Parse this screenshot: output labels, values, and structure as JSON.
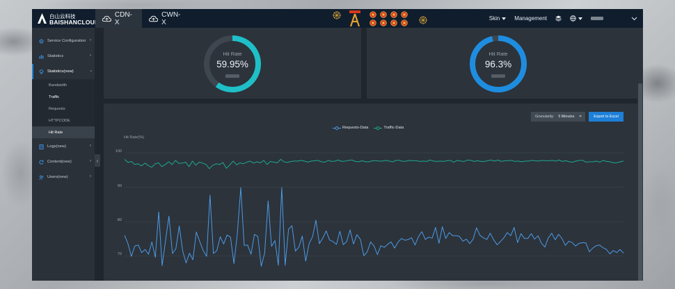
{
  "brand": {
    "cn": "白山云科技",
    "en": "BAISHANCLOUD"
  },
  "tabs": [
    {
      "label": "CDN-X",
      "active": true
    },
    {
      "label": "CWN-X",
      "active": false
    }
  ],
  "header": {
    "skin_label": "Skin",
    "management_label": "Management"
  },
  "sidebar": {
    "items": [
      {
        "label": "Service Configuration",
        "icon": "gear-icon"
      },
      {
        "label": "Statistics",
        "icon": "bar-chart-icon"
      },
      {
        "label": "Statistics(new)",
        "icon": "bulb-icon"
      },
      {
        "label": "Logs(new)",
        "icon": "document-icon"
      },
      {
        "label": "Content(new)",
        "icon": "refresh-icon"
      },
      {
        "label": "Users(new)",
        "icon": "users-icon"
      }
    ],
    "sub_items": [
      {
        "label": "Bandwidth"
      },
      {
        "label": "Traffic"
      },
      {
        "label": "Requests"
      },
      {
        "label": "HTTPCODE"
      },
      {
        "label": "Hit Rate"
      }
    ]
  },
  "gauges": [
    {
      "label": "Hit Rate",
      "value": "59.95%",
      "fraction": 0.5995,
      "color": "#1fbfc7",
      "track": "#3e464f"
    },
    {
      "label": "Hit Rate",
      "value": "96.3%",
      "fraction": 0.963,
      "color": "#1e8de0",
      "track": "#3e464f"
    }
  ],
  "controls": {
    "granularity_label": "Granularity:",
    "granularity_value": "5 Minutes",
    "export_label": "Export to Excel"
  },
  "chart_data": {
    "type": "line",
    "ylabel": "Hit Rate(%)",
    "yticks": [
      "100",
      "90",
      "80",
      "70"
    ],
    "ylim": [
      66,
      100
    ],
    "grid": true,
    "legend_position": "top-center",
    "series": [
      {
        "name": "Requests-Data",
        "color": "#4d9be6",
        "values": [
          76.0,
          73.6,
          69.9,
          72.9,
          73.2,
          71.0,
          71.9,
          70.5,
          74.1,
          69.6,
          82.8,
          67.2,
          74.5,
          81.6,
          70.7,
          72.1,
          78.7,
          71.5,
          68.0,
          70.8,
          68.9,
          77.0,
          74.2,
          71.6,
          69.9,
          87.7,
          70.7,
          71.6,
          75.6,
          73.5,
          76.1,
          75.5,
          67.8,
          76.6,
          89.9,
          73.1,
          73.2,
          70.5,
          76.3,
          75.7,
          67.0,
          70.8,
          86.0,
          72.8,
          74.5,
          67.3,
          89.9,
          67.3,
          77.8,
          78.8,
          71.4,
          72.6,
          75.8,
          68.5,
          73.6,
          75.6,
          80.4,
          73.6,
          75.2,
          77.3,
          74.6,
          74.2,
          73.4,
          77.2,
          73.3,
          74.2,
          77.6,
          73.5,
          76.2,
          74.8,
          70.1,
          71.2,
          74.1,
          72.9,
          70.4,
          73.0,
          72.5,
          73.4,
          74.1,
          72.3,
          74.0,
          75.1,
          74.6,
          74.8,
          75.3,
          73.2,
          75.6,
          77.1,
          74.8,
          75.5,
          75.2,
          78.3,
          73.7,
          78.5,
          75.1,
          76.8,
          75.9,
          75.9,
          75.7,
          74.3,
          74.9,
          73.6,
          74.9,
          78.2,
          76.0,
          75.3,
          74.8,
          76.6,
          74.7,
          73.3,
          74.2,
          75.3,
          76.8,
          75.9,
          78.3,
          73.9,
          76.5,
          75.1,
          75.1,
          76.5,
          74.9,
          75.9,
          73.7,
          72.6,
          75.3,
          76.6,
          74.7,
          76.3,
          75.1,
          73.1,
          74.3,
          73.9,
          72.9,
          73.7,
          73.9,
          73.8,
          71.2,
          72.3,
          73.0,
          73.2,
          72.4,
          71.9,
          70.6,
          71.6,
          71.0,
          71.9,
          70.8
        ]
      },
      {
        "name": "Traffic-Data",
        "color": "#1ea98f",
        "values": [
          98.1,
          97.2,
          97.5,
          96.6,
          96.8,
          96.2,
          97.0,
          96.3,
          95.8,
          96.8,
          97.1,
          96.0,
          96.6,
          97.4,
          96.6,
          97.8,
          96.9,
          97.0,
          97.3,
          96.0,
          97.6,
          96.4,
          97.3,
          97.0,
          96.6,
          95.4,
          96.4,
          96.8,
          96.6,
          97.2,
          95.5,
          96.5,
          97.6,
          96.5,
          97.1,
          96.8,
          97.3,
          97.6,
          97.0,
          97.4,
          97.1,
          97.8,
          96.6,
          97.5,
          97.3,
          97.1,
          98.1,
          97.4,
          97.2,
          97.5,
          97.6,
          97.6,
          97.8,
          97.6,
          97.3,
          97.6,
          97.7,
          97.8,
          97.4,
          97.3,
          97.8,
          97.5,
          97.6,
          97.9,
          97.5,
          97.6,
          97.8,
          97.9,
          97.5,
          97.4,
          97.7,
          97.4,
          97.4,
          97.7,
          97.7,
          97.6,
          97.6,
          97.8,
          97.6,
          97.4,
          97.8,
          97.8,
          97.5,
          97.6,
          97.8,
          97.7,
          97.7,
          97.5,
          97.6,
          97.5,
          97.9,
          97.6,
          97.5,
          97.6,
          97.5,
          97.7,
          97.8,
          97.3,
          97.8,
          97.6,
          97.5,
          97.9,
          97.8,
          97.5,
          97.7,
          97.5,
          97.5,
          97.7,
          97.9,
          97.6,
          97.9,
          97.5,
          97.7,
          97.7,
          97.8,
          97.5,
          97.6,
          97.4,
          97.6,
          97.6,
          97.8,
          97.7,
          97.6,
          97.8,
          97.7,
          97.7,
          97.8,
          97.6,
          97.9,
          97.5,
          97.7,
          97.4,
          97.3,
          97.6,
          97.8,
          97.8,
          97.3,
          97.4,
          97.4,
          97.6,
          97.3,
          97.8,
          97.5,
          97.4,
          97.1,
          97.1,
          97.4,
          97.6
        ]
      }
    ]
  }
}
